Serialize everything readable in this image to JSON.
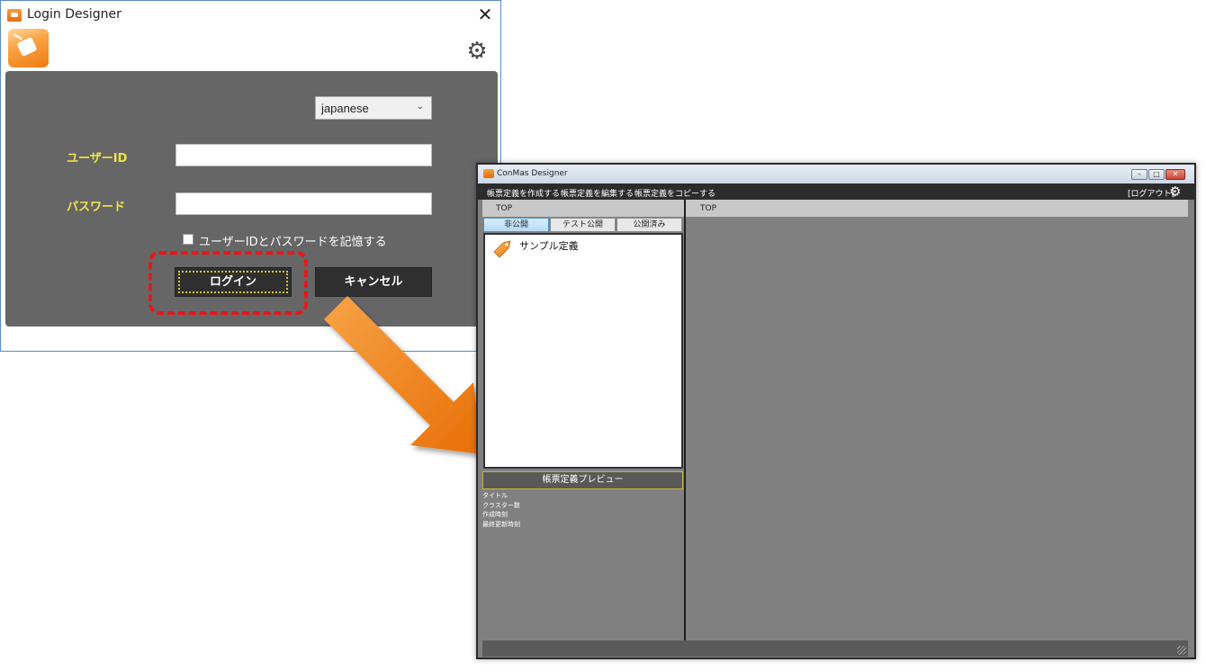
{
  "login": {
    "title": "Login Designer",
    "close_glyph": "✕",
    "settings_glyph": "⚙",
    "language": "japanese",
    "userid_label": "ユーザーID",
    "userid_value": "",
    "password_label": "パスワード",
    "password_value": "",
    "remember_label": "ユーザーIDとパスワードを記憶する",
    "login_button": "ログイン",
    "cancel_button": "キャンセル"
  },
  "designer": {
    "title": "ConMas Designer",
    "menu": {
      "create": "帳票定義を作成する",
      "edit": "帳票定義を編集する",
      "copy": "帳票定義をコピーする",
      "logout": "[ログアウト]"
    },
    "left_breadcrumb": "TOP",
    "right_breadcrumb": "TOP",
    "tabs": [
      {
        "label": "非公開",
        "active": true
      },
      {
        "label": "テスト公開",
        "active": false
      },
      {
        "label": "公開済み",
        "active": false
      }
    ],
    "definitions": [
      {
        "label": "サンプル定義"
      }
    ],
    "preview": {
      "header": "帳票定義プレビュー",
      "fields": [
        "タイトル",
        "クラスター数",
        "作成時刻",
        "最終更新時刻"
      ]
    }
  },
  "colors": {
    "highlight": "#e8171a",
    "arrow": "#f08a12",
    "label_yellow": "#f0e34a"
  }
}
